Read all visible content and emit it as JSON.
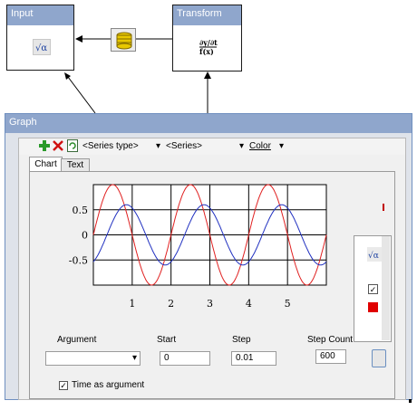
{
  "nodes": {
    "input": {
      "title": "Input",
      "icon": "sqrt-alpha-icon"
    },
    "transform": {
      "title": "Transform",
      "icon": "formula-icon"
    },
    "connector_icon": "database-icon"
  },
  "graph": {
    "title": "Graph",
    "toolbar": {
      "series_type": "<Series type>",
      "series": "<Series>",
      "color": "Color",
      "icons": [
        "add-icon",
        "delete-icon",
        "refresh-icon"
      ]
    },
    "tabs": [
      {
        "label": "Chart",
        "active": true
      },
      {
        "label": "Text",
        "active": false
      }
    ],
    "chart_data": {
      "type": "line",
      "title": "",
      "xlabel": "",
      "ylabel": "",
      "xlim": [
        0,
        6
      ],
      "ylim": [
        -1,
        1
      ],
      "x_ticks": [
        "1",
        "2",
        "3",
        "4",
        "5"
      ],
      "y_ticks": [
        "0.5",
        "0",
        "-0.5"
      ],
      "grid": true,
      "series": [
        {
          "color": "#e02020",
          "amplitude": 1.0,
          "period": 2.0,
          "phase": 0.0
        },
        {
          "color": "#2030c0",
          "amplitude": 0.6,
          "period": 2.0,
          "phase": -0.35
        }
      ]
    },
    "params": {
      "argument_label": "Argument",
      "argument_value": "",
      "start_label": "Start",
      "start_value": "0",
      "step_label": "Step",
      "step_value": "0.01",
      "step_count_label": "Step Count",
      "step_count_value": "600",
      "time_as_argument_label": "Time as argument",
      "time_as_argument_checked": true
    },
    "side": {
      "checked": true,
      "swatch_color": "#e00000"
    }
  }
}
